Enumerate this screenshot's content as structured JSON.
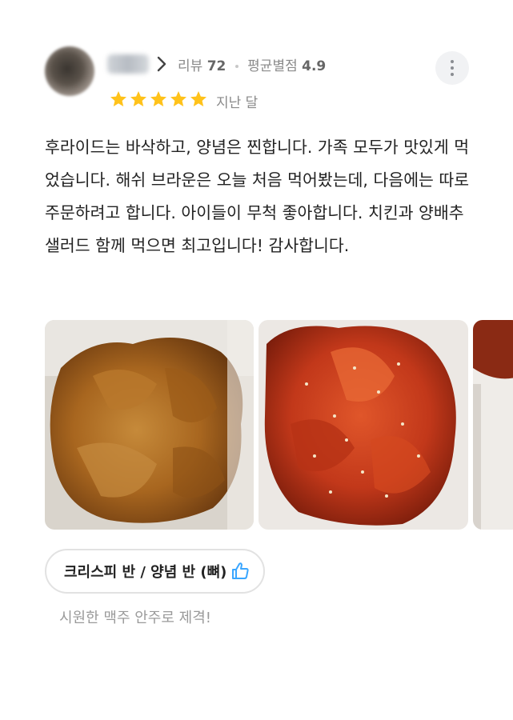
{
  "review_header": {
    "review_count_label": "리뷰",
    "review_count": "72",
    "avg_rating_label": "평균별점",
    "avg_rating": "4.9",
    "rating_stars": 5,
    "date": "지난 달"
  },
  "review": {
    "text": "후라이드는 바삭하고, 양념은 찐합니다. 가족 모두가 맛있게 먹었습니다. 해쉬 브라운은 오늘 처음 먹어봤는데, 다음에는 따로 주문하려고 합니다. 아이들이 무척 좋아합니다. 치킨과 양배추 샐러드 함께 먹으면 최고입니다! 감사합니다."
  },
  "photos": [
    {
      "icon": "fried-chicken-photo"
    },
    {
      "icon": "yangnyeom-chicken-photo"
    },
    {
      "icon": "partial-photo"
    }
  ],
  "menu": {
    "label": "크리스피 반 / 양념 반 (뼈)",
    "icon": "thumbs-up-icon",
    "accent": "#3aa6ff"
  },
  "comment": "시원한 맥주 안주로 제격!",
  "colors": {
    "star": "#ffc21a",
    "meta_text": "#8a8a8a",
    "body_text": "#222222"
  }
}
